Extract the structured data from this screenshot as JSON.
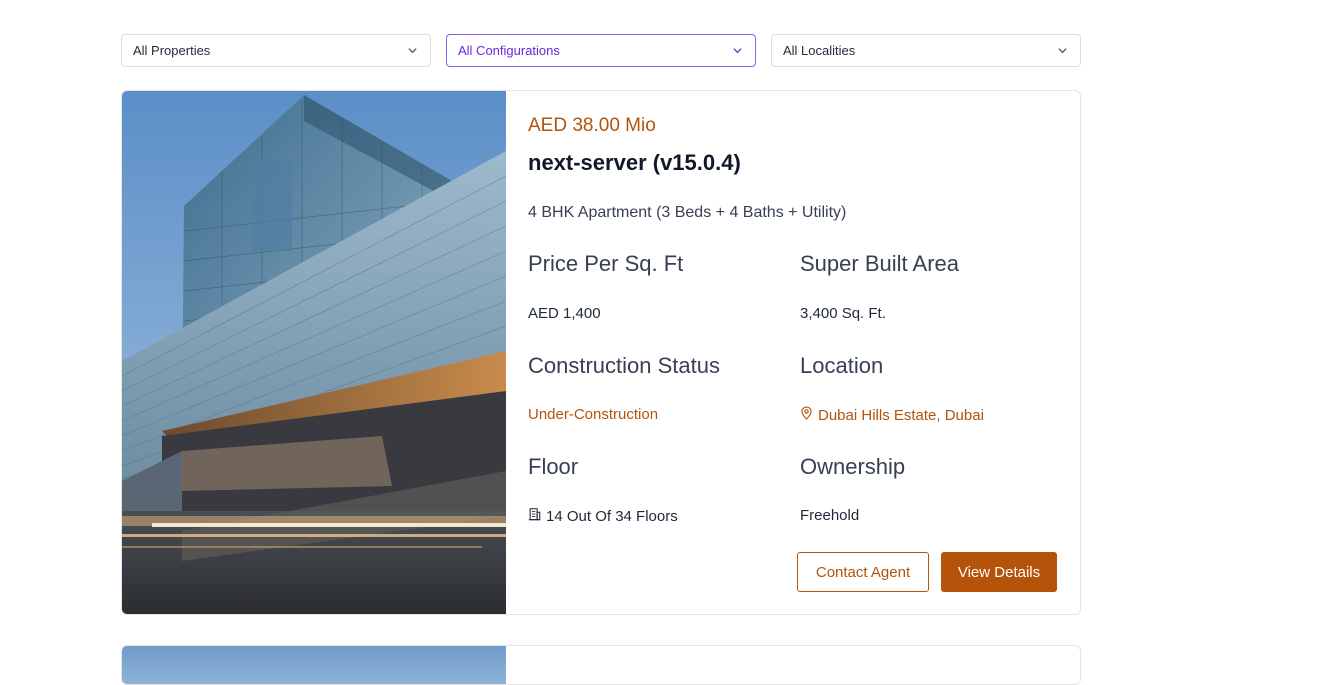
{
  "filters": {
    "properties": "All Properties",
    "configurations": "All Configurations",
    "localities": "All Localities"
  },
  "listing": {
    "price": "AED 38.00 Mio",
    "title": "next-server (v15.0.4)",
    "configuration": "4 BHK Apartment (3 Beds + 4 Baths + Utility)",
    "fields": {
      "price_per_sqft_label": "Price Per Sq. Ft",
      "price_per_sqft_value": "AED 1,400",
      "super_built_area_label": "Super Built Area",
      "super_built_area_value": "3,400 Sq. Ft.",
      "construction_status_label": "Construction Status",
      "construction_status_value": "Under-Construction",
      "location_label": "Location",
      "location_value": "Dubai Hills Estate, Dubai",
      "floor_label": "Floor",
      "floor_value": "14 Out Of 34 Floors",
      "ownership_label": "Ownership",
      "ownership_value": "Freehold"
    },
    "actions": {
      "contact": "Contact Agent",
      "view": "View Details"
    },
    "icons": {
      "location": "map-pin-icon",
      "floor": "building-icon"
    }
  },
  "colors": {
    "accent": "#b45309",
    "active_filter": "#8b5cf6"
  }
}
